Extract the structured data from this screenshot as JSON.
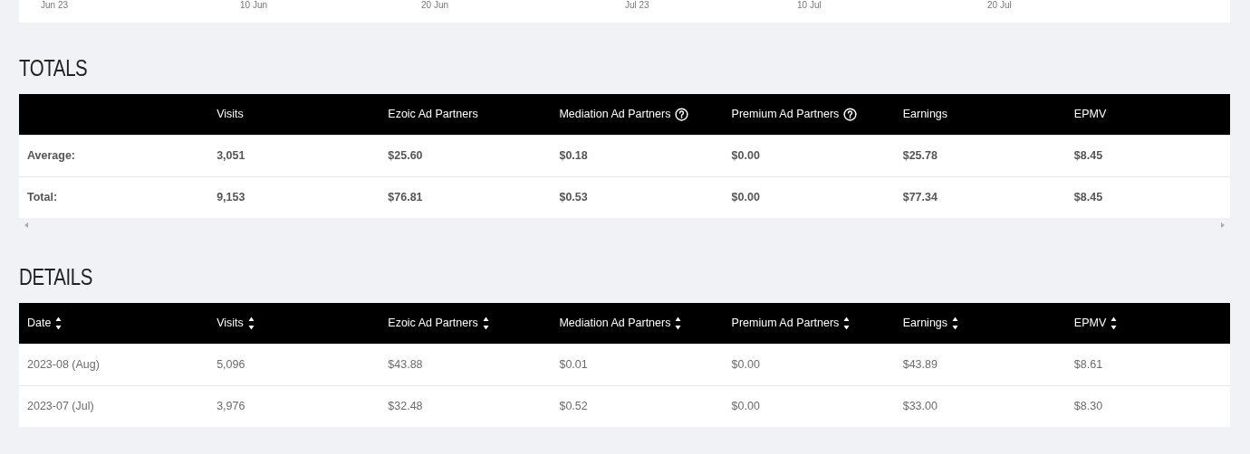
{
  "chart_axis": {
    "labels": [
      "Jun 23",
      "10 Jun",
      "20 Jun",
      "Jul 23",
      "10 Jul",
      "20 Jul"
    ]
  },
  "totals": {
    "title": "TOTALS",
    "columns": [
      {
        "help": false,
        "sortable": false
      },
      {
        "label": "Visits",
        "help": false,
        "sortable": false
      },
      {
        "label": "Ezoic Ad Partners",
        "help": false,
        "sortable": false
      },
      {
        "label": "Mediation Ad Partners",
        "help": true,
        "sortable": false
      },
      {
        "label": "Premium Ad Partners",
        "help": true,
        "sortable": false
      },
      {
        "label": "Earnings",
        "help": false,
        "sortable": false
      },
      {
        "label": "EPMV",
        "help": false,
        "sortable": false
      }
    ],
    "rows": [
      [
        "Average:",
        "3,051",
        "$25.60",
        "$0.18",
        "$0.00",
        "$25.78",
        "$8.45"
      ],
      [
        "Total:",
        "9,153",
        "$76.81",
        "$0.53",
        "$0.00",
        "$77.34",
        "$8.45"
      ]
    ]
  },
  "details": {
    "title": "DETAILS",
    "columns": [
      {
        "label": "Date",
        "help": false,
        "sortable": true
      },
      {
        "label": "Visits",
        "help": false,
        "sortable": true
      },
      {
        "label": "Ezoic Ad Partners",
        "help": false,
        "sortable": true
      },
      {
        "label": "Mediation Ad Partners",
        "help": false,
        "sortable": true
      },
      {
        "label": "Premium Ad Partners",
        "help": false,
        "sortable": true
      },
      {
        "label": "Earnings",
        "help": false,
        "sortable": true
      },
      {
        "label": "EPMV",
        "help": false,
        "sortable": true
      }
    ],
    "rows": [
      [
        "2023-08 (Aug)",
        "5,096",
        "$43.88",
        "$0.01",
        "$0.00",
        "$43.89",
        "$8.61"
      ],
      [
        "2023-07 (Jul)",
        "3,976",
        "$32.48",
        "$0.52",
        "$0.00",
        "$33.00",
        "$8.30"
      ]
    ]
  }
}
